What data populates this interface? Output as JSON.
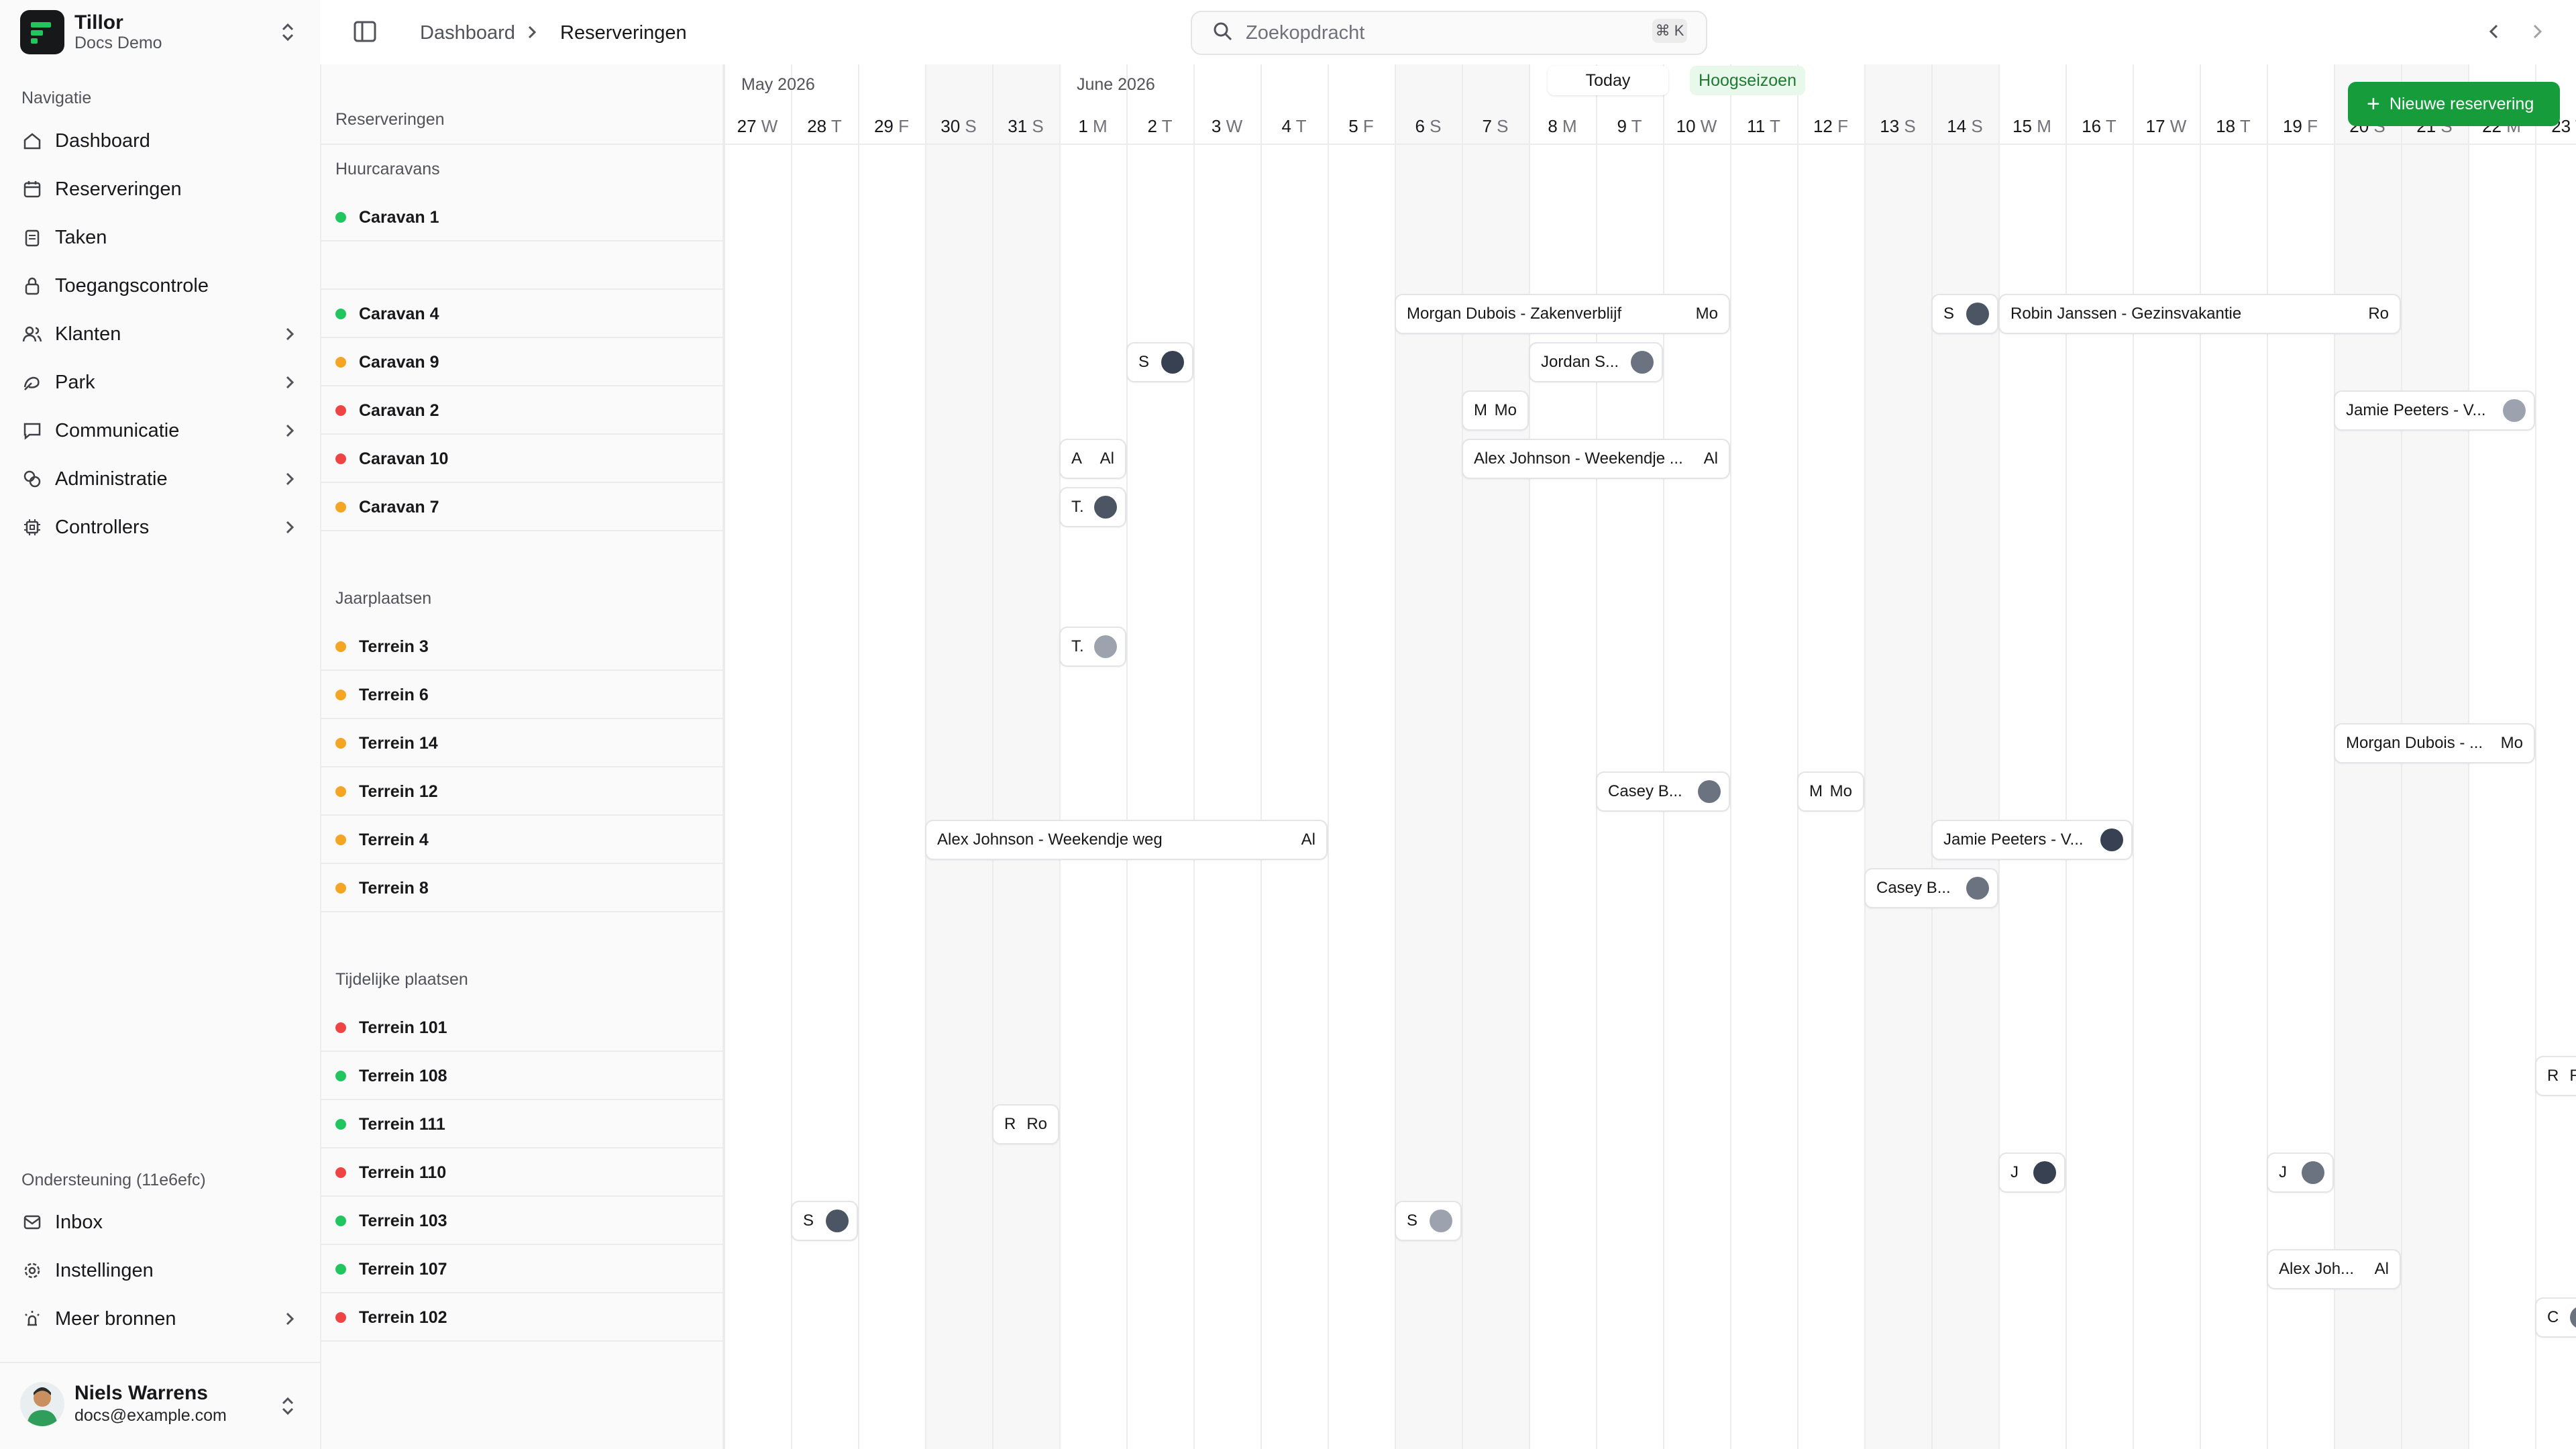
{
  "app": {
    "brand": "Tillor",
    "workspace": "Docs Demo"
  },
  "sidebar": {
    "section_label": "Navigatie",
    "items": [
      {
        "label": "Dashboard",
        "icon": "home-icon"
      },
      {
        "label": "Reserveringen",
        "icon": "calendar-icon"
      },
      {
        "label": "Taken",
        "icon": "clipboard-icon"
      },
      {
        "label": "Toegangscontrole",
        "icon": "lock-icon"
      },
      {
        "label": "Klanten",
        "icon": "users-icon"
      },
      {
        "label": "Park",
        "icon": "tree-icon"
      },
      {
        "label": "Communicatie",
        "icon": "chat-icon"
      },
      {
        "label": "Administratie",
        "icon": "coins-icon"
      },
      {
        "label": "Controllers",
        "icon": "chip-icon"
      }
    ],
    "support_label": "Ondersteuning (11e6efc)",
    "support_items": [
      {
        "label": "Inbox",
        "icon": "inbox-icon"
      },
      {
        "label": "Instellingen",
        "icon": "gear-icon"
      },
      {
        "label": "Meer bronnen",
        "icon": "lamp-icon"
      }
    ],
    "user": {
      "name": "Niels Warrens",
      "email": "docs@example.com"
    }
  },
  "header": {
    "breadcrumb": [
      "Dashboard",
      "Reserveringen"
    ],
    "search_placeholder": "Zoekopdracht",
    "search_shortcut": "⌘ K"
  },
  "calendar": {
    "column_title": "Reserveringen",
    "months": [
      "May 2026",
      "June 2026"
    ],
    "today_label": "Today",
    "season_label": "Hoogseizoen",
    "new_button": "Nieuwe reservering",
    "days": [
      {
        "d": "27",
        "w": "W"
      },
      {
        "d": "28",
        "w": "T"
      },
      {
        "d": "29",
        "w": "F"
      },
      {
        "d": "30",
        "w": "S"
      },
      {
        "d": "31",
        "w": "S"
      },
      {
        "d": "1",
        "w": "M"
      },
      {
        "d": "2",
        "w": "T"
      },
      {
        "d": "3",
        "w": "W"
      },
      {
        "d": "4",
        "w": "T"
      },
      {
        "d": "5",
        "w": "F"
      },
      {
        "d": "6",
        "w": "S"
      },
      {
        "d": "7",
        "w": "S"
      },
      {
        "d": "8",
        "w": "M"
      },
      {
        "d": "9",
        "w": "T"
      },
      {
        "d": "10",
        "w": "W"
      },
      {
        "d": "11",
        "w": "T"
      },
      {
        "d": "12",
        "w": "F"
      },
      {
        "d": "13",
        "w": "S"
      },
      {
        "d": "14",
        "w": "S"
      },
      {
        "d": "15",
        "w": "M"
      },
      {
        "d": "16",
        "w": "T"
      },
      {
        "d": "17",
        "w": "W"
      },
      {
        "d": "18",
        "w": "T"
      },
      {
        "d": "19",
        "w": "F"
      },
      {
        "d": "20",
        "w": "S"
      },
      {
        "d": "21",
        "w": "S"
      },
      {
        "d": "22",
        "w": "M"
      },
      {
        "d": "23",
        "w": "T"
      }
    ],
    "groups": [
      {
        "title": "Huurcaravans",
        "rows": [
          {
            "label": "Caravan 1",
            "status": "green"
          },
          {
            "label": "",
            "status": ""
          },
          {
            "label": "Caravan 4",
            "status": "green"
          },
          {
            "label": "Caravan 9",
            "status": "orange"
          },
          {
            "label": "Caravan 2",
            "status": "red"
          },
          {
            "label": "Caravan 10",
            "status": "red"
          },
          {
            "label": "Caravan 7",
            "status": "orange"
          }
        ]
      },
      {
        "title": "Jaarplaatsen",
        "rows": [
          {
            "label": "Terrein 3",
            "status": "orange"
          },
          {
            "label": "Terrein 6",
            "status": "orange"
          },
          {
            "label": "Terrein 14",
            "status": "orange"
          },
          {
            "label": "Terrein 12",
            "status": "orange"
          },
          {
            "label": "Terrein 4",
            "status": "orange"
          },
          {
            "label": "Terrein 8",
            "status": "orange"
          }
        ]
      },
      {
        "title": "Tijdelijke plaatsen",
        "rows": [
          {
            "label": "Terrein 101",
            "status": "red"
          },
          {
            "label": "Terrein 108",
            "status": "green"
          },
          {
            "label": "Terrein 111",
            "status": "green"
          },
          {
            "label": "Terrein 110",
            "status": "red"
          },
          {
            "label": "Terrein 103",
            "status": "green"
          },
          {
            "label": "Terrein 107",
            "status": "green"
          },
          {
            "label": "Terrein 102",
            "status": "red"
          }
        ]
      }
    ],
    "reservations": [
      {
        "row": "Caravan 4",
        "start": 10,
        "days": 5,
        "text": "Morgan Dubois - Zakenverblijf",
        "ini": "Mo"
      },
      {
        "row": "Caravan 4",
        "start": 18,
        "days": 1,
        "text": "S",
        "avatar": true
      },
      {
        "row": "Caravan 4",
        "start": 19,
        "days": 6,
        "text": "Robin Janssen - Gezinsvakantie",
        "ini": "Ro"
      },
      {
        "row": "Caravan 9",
        "start": 6,
        "days": 1,
        "text": "S",
        "avatar": true
      },
      {
        "row": "Caravan 9",
        "start": 12,
        "days": 2,
        "text": "Jordan S...",
        "avatar": true
      },
      {
        "row": "Caravan 2",
        "start": 11,
        "days": 1,
        "text": "M",
        "ini": "Mo"
      },
      {
        "row": "Caravan 2",
        "start": 24,
        "days": 3,
        "text": "Jamie Peeters - V...",
        "avatar": true
      },
      {
        "row": "Caravan 10",
        "start": 5,
        "days": 1,
        "text": "A",
        "ini": "Al"
      },
      {
        "row": "Caravan 10",
        "start": 11,
        "days": 4,
        "text": "Alex Johnson - Weekendje ...",
        "ini": "Al"
      },
      {
        "row": "Caravan 7",
        "start": 5,
        "days": 1,
        "text": "T.",
        "avatar": true
      },
      {
        "row": "Terrein 3",
        "start": 5,
        "days": 1,
        "text": "T.",
        "avatar": true
      },
      {
        "row": "Terrein 14",
        "start": 24,
        "days": 3,
        "text": "Morgan Dubois - ...",
        "ini": "Mo"
      },
      {
        "row": "Terrein 12",
        "start": 13,
        "days": 2,
        "text": "Casey B...",
        "avatar": true
      },
      {
        "row": "Terrein 12",
        "start": 16,
        "days": 1,
        "text": "M",
        "ini": "Mo"
      },
      {
        "row": "Terrein 4",
        "start": 3,
        "days": 6,
        "text": "Alex Johnson - Weekendje weg",
        "ini": "Al"
      },
      {
        "row": "Terrein 4",
        "start": 18,
        "days": 3,
        "text": "Jamie Peeters - V...",
        "avatar": true
      },
      {
        "row": "Terrein 8",
        "start": 17,
        "days": 2,
        "text": "Casey B...",
        "avatar": true
      },
      {
        "row": "Terrein 108",
        "start": 27,
        "days": 1,
        "text": "R",
        "ini": "Ro"
      },
      {
        "row": "Terrein 111",
        "start": 4,
        "days": 1,
        "text": "R",
        "ini": "Ro"
      },
      {
        "row": "Terrein 110",
        "start": 19,
        "days": 1,
        "text": "J",
        "avatar": true
      },
      {
        "row": "Terrein 110",
        "start": 23,
        "days": 1,
        "text": "J",
        "avatar": true
      },
      {
        "row": "Terrein 103",
        "start": 1,
        "days": 1,
        "text": "S",
        "avatar": true
      },
      {
        "row": "Terrein 103",
        "start": 10,
        "days": 1,
        "text": "S",
        "avatar": true
      },
      {
        "row": "Terrein 107",
        "start": 23,
        "days": 2,
        "text": "Alex Joh...",
        "ini": "Al"
      },
      {
        "row": "Terrein 102",
        "start": 27,
        "days": 1,
        "text": "C",
        "avatar": true
      }
    ]
  },
  "colors": {
    "green": "#22c55e",
    "orange": "#f5a524",
    "red": "#ef4444",
    "brand": "#169c3b"
  }
}
